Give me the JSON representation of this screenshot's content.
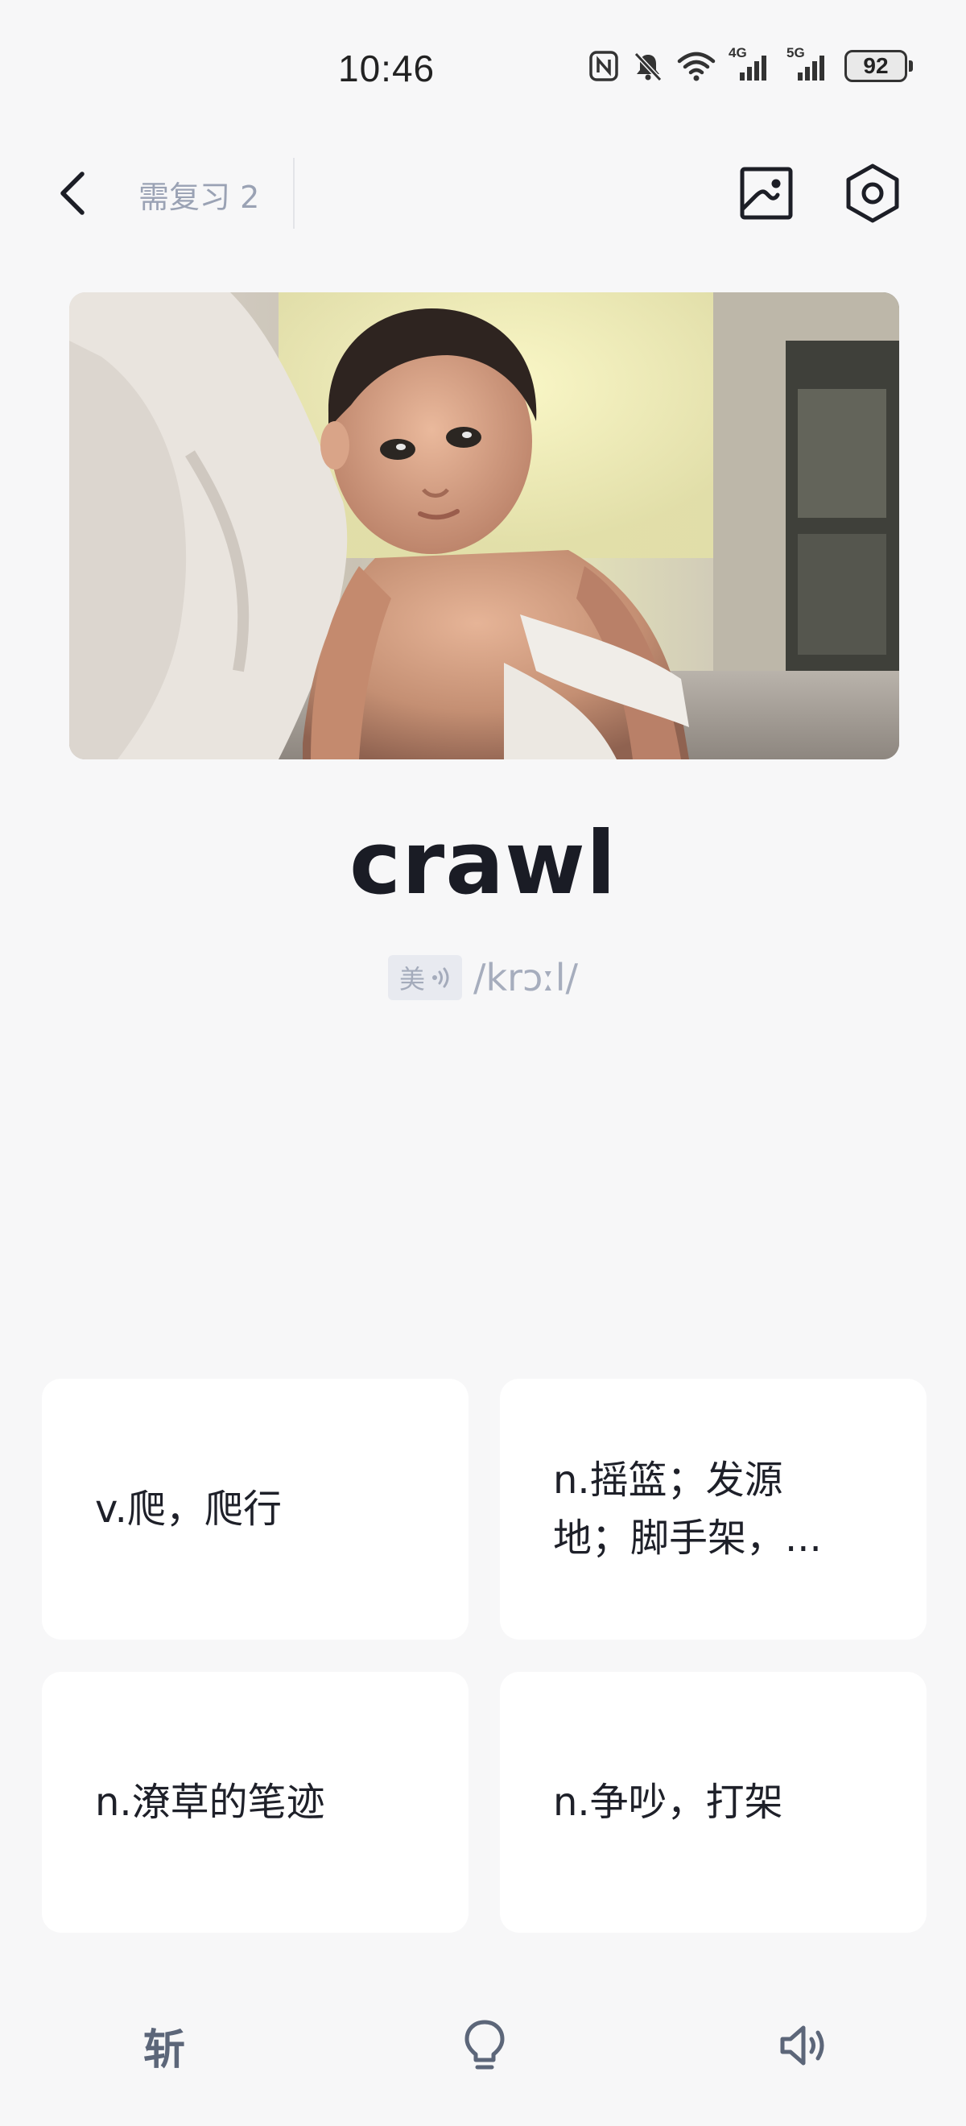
{
  "status_bar": {
    "time": "10:46",
    "battery": "92",
    "network_1": "4G",
    "network_2": "5G",
    "icons": [
      "nfc-icon",
      "mute-icon",
      "wifi-icon",
      "signal-4g-icon",
      "signal-5g-icon",
      "battery-icon"
    ]
  },
  "nav": {
    "review_label": "需复习 2",
    "icons": [
      "back-icon",
      "chart-icon",
      "settings-icon"
    ]
  },
  "word": {
    "text": "crawl",
    "accent": "美",
    "phonetic": "/krɔːl/"
  },
  "options": [
    {
      "text": "v.爬，爬行"
    },
    {
      "text": "n.摇篮；发源地；脚手架，..."
    },
    {
      "text": "n.潦草的笔迹"
    },
    {
      "text": "n.争吵，打架"
    }
  ],
  "bottom_bar": {
    "chop_label": "斩",
    "icons": [
      "bulb-icon",
      "speaker-icon"
    ]
  },
  "colors": {
    "background": "#f7f7f8",
    "card": "#ffffff",
    "muted_text": "#9aa2b4",
    "word_text": "#1a1c25"
  }
}
